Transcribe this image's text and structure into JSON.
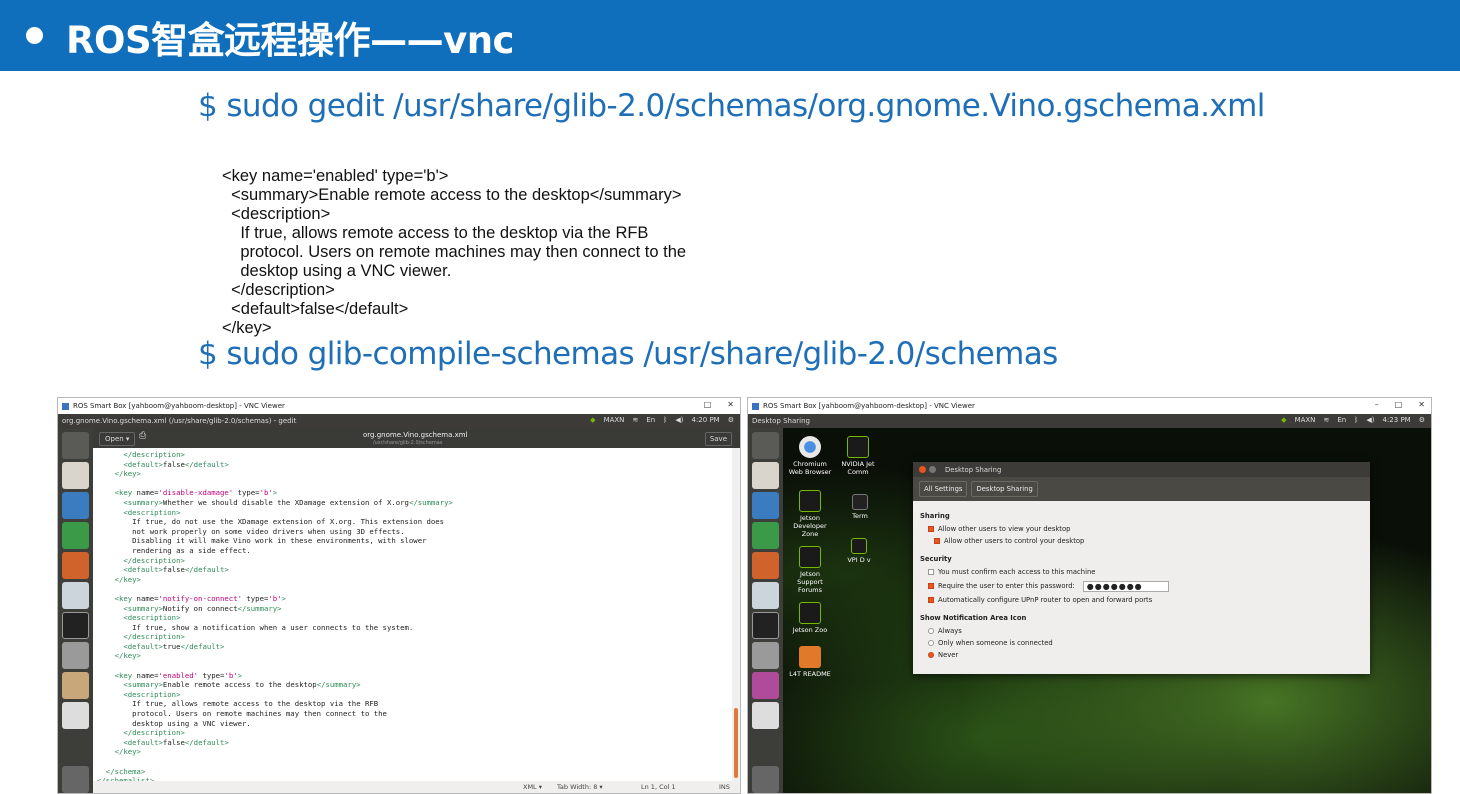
{
  "header": {
    "title": "ROS智盒远程操作——vnc"
  },
  "commands": {
    "gedit": "$ sudo gedit /usr/share/glib-2.0/schemas/org.gnome.Vino.gschema.xml",
    "compile": "$ sudo glib-compile-schemas /usr/share/glib-2.0/schemas"
  },
  "xml_snippet": [
    "<key name='enabled' type='b'>",
    "  <summary>Enable remote access to the desktop</summary>",
    "  <description>",
    "    If true, allows remote access to the desktop via the RFB",
    "    protocol. Users on remote machines may then connect to the",
    "    desktop using a VNC viewer.",
    "  </description>",
    "  <default>false</default>",
    "</key>"
  ],
  "left_window": {
    "title": "ROS Smart Box [yahboom@yahboom-desktop] - VNC Viewer",
    "app_title": "org.gnome.Vino.gschema.xml (/usr/share/glib-2.0/schemas) - gedit",
    "indicators": [
      "MAXN",
      "En",
      "4:20 PM"
    ],
    "open_label": "Open",
    "doc_name": "org.gnome.Vino.gschema.xml",
    "doc_path": "/usr/share/glib-2.0/schemas",
    "save_label": "Save",
    "code_lines": [
      "      </description>",
      "      <default>false</default>",
      "    </key>",
      "",
      "    <key name='disable-xdamage' type='b'>",
      "      <summary>Whether we should disable the XDamage extension of X.org</summary>",
      "      <description>",
      "        If true, do not use the XDamage extension of X.org. This extension does",
      "        not work properly on some video drivers when using 3D effects.",
      "        Disabling it will make Vino work in these environments, with slower",
      "        rendering as a side effect.",
      "      </description>",
      "      <default>false</default>",
      "    </key>",
      "",
      "    <key name='notify-on-connect' type='b'>",
      "      <summary>Notify on connect</summary>",
      "      <description>",
      "        If true, show a notification when a user connects to the system.",
      "      </description>",
      "      <default>true</default>",
      "    </key>",
      "",
      "    <key name='enabled' type='b'>",
      "      <summary>Enable remote access to the desktop</summary>",
      "      <description>",
      "        If true, allows remote access to the desktop via the RFB",
      "        protocol. Users on remote machines may then connect to the",
      "        desktop using a VNC viewer.",
      "      </description>",
      "      <default>false</default>",
      "    </key>",
      "",
      "  </schema>",
      "</schemalist>"
    ],
    "status": {
      "lang": "XML ▾",
      "tab_width": "Tab Width: 8 ▾",
      "position": "Ln 1, Col 1",
      "mode": "INS"
    }
  },
  "right_window": {
    "title": "ROS Smart Box [yahboom@yahboom-desktop] - VNC Viewer",
    "app_title": "Desktop Sharing",
    "indicators": [
      "MAXN",
      "En",
      "4:23 PM"
    ],
    "desktop_icons": [
      "Chromium Web Browser",
      "Jetson Developer Zone",
      "Jetson Support Forums",
      "Jetson Zoo",
      "L4T README",
      "NVIDIA Jet Comm",
      "Term",
      "VPI D v"
    ],
    "dialog": {
      "title": "Desktop Sharing",
      "tabs": [
        "All Settings",
        "Desktop Sharing"
      ],
      "sharing_heading": "Sharing",
      "allow_view": "Allow other users to view your desktop",
      "allow_control": "Allow other users to control your desktop",
      "security_heading": "Security",
      "confirm_access": "You must confirm each access to this machine",
      "require_password": "Require the user to enter this password:",
      "password_value": "●●●●●●●",
      "upnp": "Automatically configure UPnP router to open and forward ports",
      "notify_heading": "Show Notification Area Icon",
      "notify_always": "Always",
      "notify_connected": "Only when someone is connected",
      "notify_never": "Never"
    }
  }
}
